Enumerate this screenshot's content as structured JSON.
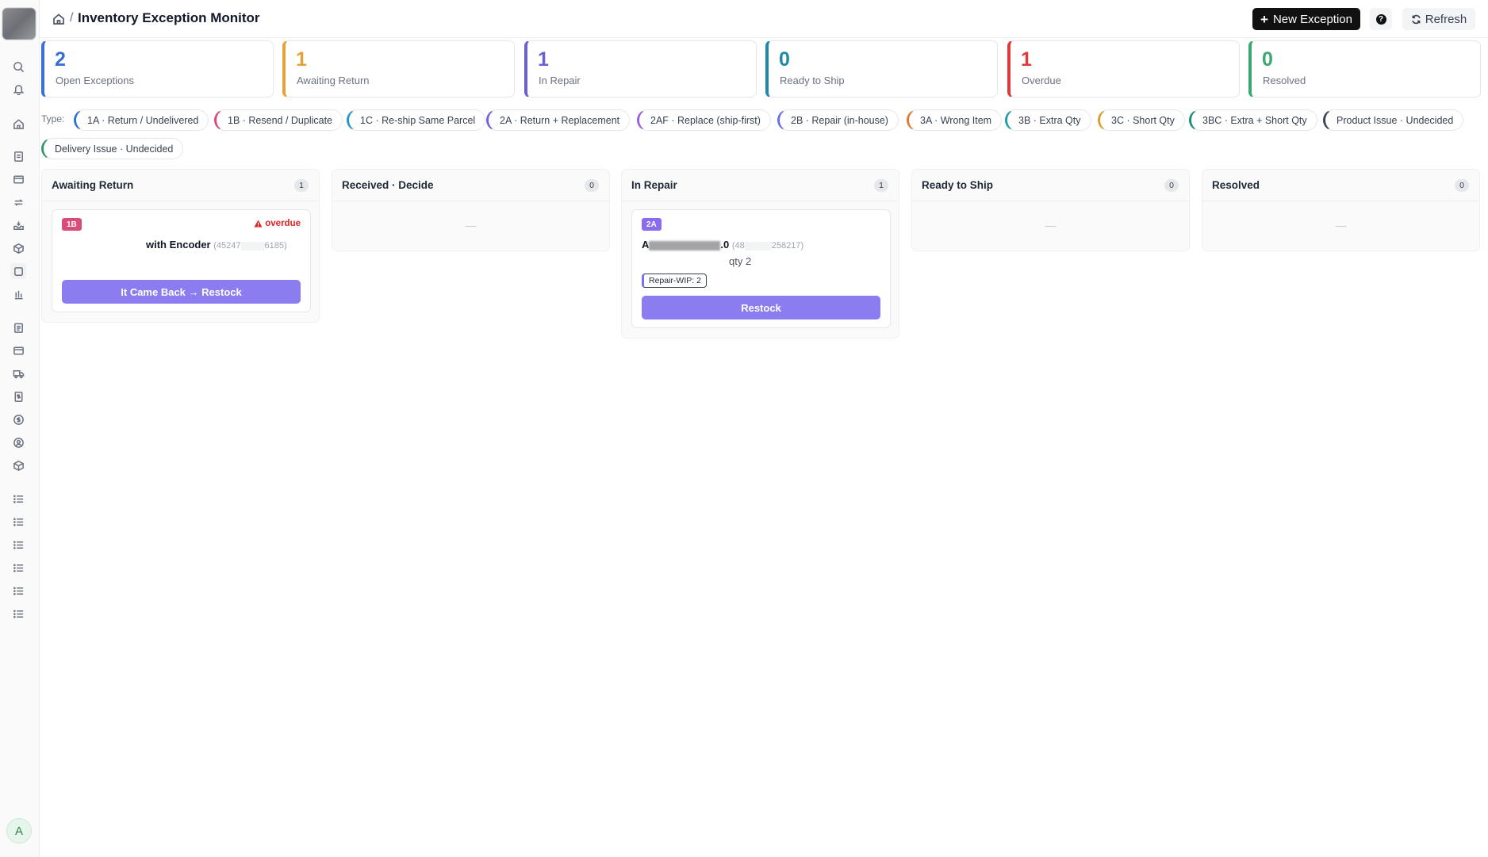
{
  "header": {
    "breadcrumb_separator": "/",
    "title": "Inventory Exception Monitor",
    "new_button": "New Exception",
    "help_label": "?",
    "refresh_button": "Refresh"
  },
  "stats": [
    {
      "value": "2",
      "label": "Open Exceptions",
      "color": "#3b6fd6"
    },
    {
      "value": "1",
      "label": "Awaiting Return",
      "color": "#e4a23a"
    },
    {
      "value": "1",
      "label": "In Repair",
      "color": "#6a5fd9"
    },
    {
      "value": "0",
      "label": "Ready to Ship",
      "color": "#1e8aa8"
    },
    {
      "value": "1",
      "label": "Overdue",
      "color": "#dc3b3b"
    },
    {
      "value": "0",
      "label": "Resolved",
      "color": "#3aa873"
    }
  ],
  "filters": {
    "label": "Type:",
    "chips": [
      {
        "label": "1A · Return / Undelivered",
        "color": "#2f6fd6"
      },
      {
        "label": "1B · Resend / Duplicate",
        "color": "#d94b7a"
      },
      {
        "label": "1C · Re-ship Same Parcel",
        "color": "#2196c8"
      },
      {
        "label": "2A · Return + Replacement",
        "color": "#7a5fe0"
      },
      {
        "label": "2AF · Replace (ship-first)",
        "color": "#9a5fd9"
      },
      {
        "label": "2B · Repair (in-house)",
        "color": "#6a6fe0"
      },
      {
        "label": "3A · Wrong Item",
        "color": "#e07a2f"
      },
      {
        "label": "3B · Extra Qty",
        "color": "#1e9aa8"
      },
      {
        "label": "3C · Short Qty",
        "color": "#d9a02f"
      },
      {
        "label": "3BC · Extra + Short Qty",
        "color": "#1e8a7a"
      },
      {
        "label": "Product Issue · Undecided",
        "color": "#374151"
      },
      {
        "label": "Delivery Issue · Undecided",
        "color": "#2f9a6a"
      }
    ]
  },
  "columns": [
    {
      "title": "Awaiting Return",
      "count": "1"
    },
    {
      "title": "Received · Decide",
      "count": "0",
      "empty": "—"
    },
    {
      "title": "In Repair",
      "count": "1"
    },
    {
      "title": "Ready to Ship",
      "count": "0",
      "empty": "—"
    },
    {
      "title": "Resolved",
      "count": "0",
      "empty": "—"
    }
  ],
  "cards": {
    "awaiting": {
      "badge": "1B",
      "badge_color": "#d94b7a",
      "overdue": "overdue",
      "name": "with Encoder",
      "sku_start": "(45247",
      "sku_end": "6185)",
      "action": "It Came Back → Restock"
    },
    "repair": {
      "badge": "2A",
      "badge_color": "#8b6cf0",
      "name_start": "A",
      "name_end": ".0",
      "sku_start": "(48",
      "sku_end": "258217)",
      "qty": "qty 2",
      "wip": "Repair-WIP: 2",
      "action": "Restock"
    }
  },
  "user": {
    "initial": "A"
  }
}
